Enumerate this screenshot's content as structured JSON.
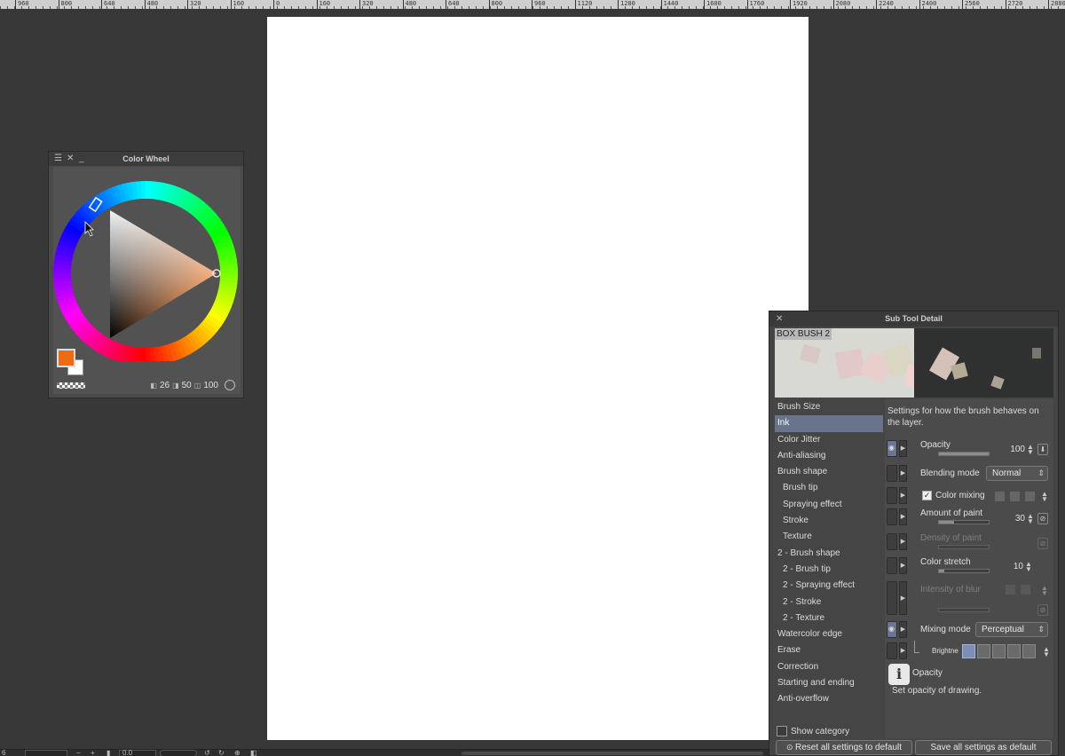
{
  "ruler": {
    "ticks": [
      "960",
      "800",
      "640",
      "480",
      "320",
      "160",
      "0",
      "160",
      "320",
      "480",
      "640",
      "800",
      "960",
      "1120",
      "1280",
      "1440",
      "1600",
      "1760",
      "1920",
      "2080",
      "2240",
      "2400",
      "2560",
      "2720",
      "2880"
    ]
  },
  "color_wheel": {
    "title": "Color Wheel",
    "main_color": "#f06a10",
    "sub_color": "#ffffff",
    "h_value": "26",
    "s_value": "50",
    "v_value": "100"
  },
  "sub_tool": {
    "title": "Sub Tool Detail",
    "brush_name": "BOX BUSH 2",
    "categories": [
      {
        "label": "Brush Size",
        "sub": false,
        "selected": false
      },
      {
        "label": "Ink",
        "sub": false,
        "selected": true
      },
      {
        "label": "Color Jitter",
        "sub": false,
        "selected": false
      },
      {
        "label": "Anti-aliasing",
        "sub": false,
        "selected": false
      },
      {
        "label": "Brush shape",
        "sub": false,
        "selected": false
      },
      {
        "label": "Brush tip",
        "sub": true,
        "selected": false
      },
      {
        "label": "Spraying effect",
        "sub": true,
        "selected": false
      },
      {
        "label": "Stroke",
        "sub": true,
        "selected": false
      },
      {
        "label": "Texture",
        "sub": true,
        "selected": false
      },
      {
        "label": "2 - Brush shape",
        "sub": false,
        "selected": false
      },
      {
        "label": "2 - Brush tip",
        "sub": true,
        "selected": false
      },
      {
        "label": "2 - Spraying effect",
        "sub": true,
        "selected": false
      },
      {
        "label": "2 - Stroke",
        "sub": true,
        "selected": false
      },
      {
        "label": "2 - Texture",
        "sub": true,
        "selected": false
      },
      {
        "label": "Watercolor edge",
        "sub": false,
        "selected": false
      },
      {
        "label": "Erase",
        "sub": false,
        "selected": false
      },
      {
        "label": "Correction",
        "sub": false,
        "selected": false
      },
      {
        "label": "Starting and ending",
        "sub": false,
        "selected": false
      },
      {
        "label": "Anti-overflow",
        "sub": false,
        "selected": false
      }
    ],
    "description": "Settings for how the brush behaves on the layer.",
    "opacity": {
      "label": "Opacity",
      "value": "100",
      "level": 1.0
    },
    "blending_mode": {
      "label": "Blending mode",
      "value": "Normal"
    },
    "color_mixing": {
      "label": "Color mixing",
      "checked": true
    },
    "amount_of_paint": {
      "label": "Amount of paint",
      "value": "30",
      "level": 0.3
    },
    "density_of_paint": {
      "label": "Density of paint"
    },
    "color_stretch": {
      "label": "Color stretch",
      "value": "10",
      "level": 0.1
    },
    "intensity_of_blur": {
      "label": "Intensity of blur"
    },
    "mixing_mode": {
      "label": "Mixing mode",
      "value": "Perceptual"
    },
    "brightness": {
      "label": "Brightne"
    },
    "info": {
      "title": "Opacity",
      "text": "Set opacity of drawing."
    },
    "show_category": "Show category",
    "reset_button": "Reset all settings to default",
    "save_button": "Save all settings as default"
  },
  "statusbar": {
    "zoom": "6",
    "angle": "0.0"
  }
}
